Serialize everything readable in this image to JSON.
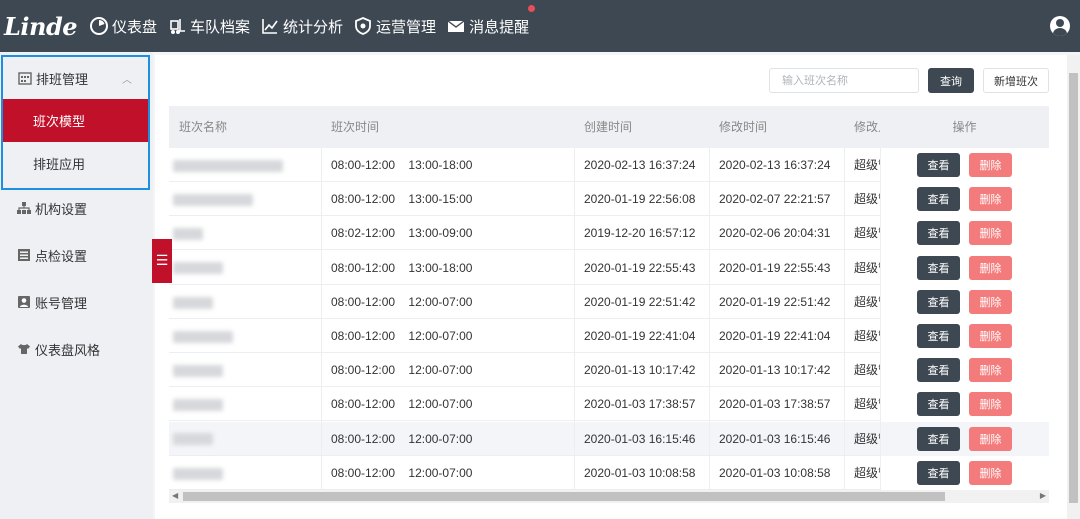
{
  "app": {
    "logo_text": "Linde",
    "brand_color": "#c0102a",
    "topbar_color": "#3d4852"
  },
  "nav": [
    {
      "label": "仪表盘",
      "icon": "gauge-icon"
    },
    {
      "label": "车队档案",
      "icon": "forklift-icon"
    },
    {
      "label": "统计分析",
      "icon": "chart-icon"
    },
    {
      "label": "运营管理",
      "icon": "shield-icon"
    },
    {
      "label": "消息提醒",
      "icon": "mail-icon",
      "has_badge": true
    }
  ],
  "sidebar": {
    "group": {
      "label": "排班管理",
      "icon": "calendar-icon",
      "expanded": true,
      "items": [
        {
          "label": "班次模型",
          "active": true
        },
        {
          "label": "排班应用",
          "active": false
        }
      ]
    },
    "items": [
      {
        "label": "机构设置",
        "icon": "org-icon"
      },
      {
        "label": "点检设置",
        "icon": "checklist-icon"
      },
      {
        "label": "账号管理",
        "icon": "account-icon"
      },
      {
        "label": "仪表盘风格",
        "icon": "shirt-icon"
      }
    ]
  },
  "toolbar": {
    "search_placeholder": "输入班次名称",
    "query_label": "查询",
    "add_label": "新增班次"
  },
  "table": {
    "columns": [
      "班次名称",
      "班次时间",
      "创建时间",
      "修改时间",
      "修改人",
      "操作"
    ],
    "view_label": "查看",
    "delete_label": "删除",
    "rows": [
      {
        "time": "08:00-12:00    13:00-18:00",
        "created": "2020-02-13 16:37:24",
        "modified": "2020-02-13 16:37:24",
        "modifier": "超级管理员"
      },
      {
        "time": "08:00-12:00    13:00-15:00",
        "created": "2020-01-19 22:56:08",
        "modified": "2020-02-07 22:21:57",
        "modifier": "超级管理员"
      },
      {
        "time": "08:02-12:00    13:00-09:00",
        "created": "2019-12-20 16:57:12",
        "modified": "2020-02-06 20:04:31",
        "modifier": "超级管理员"
      },
      {
        "time": "08:00-12:00    13:00-18:00",
        "created": "2020-01-19 22:55:43",
        "modified": "2020-01-19 22:55:43",
        "modifier": "超级管理员"
      },
      {
        "time": "08:00-12:00    12:00-07:00",
        "created": "2020-01-19 22:51:42",
        "modified": "2020-01-19 22:51:42",
        "modifier": "超级管理员"
      },
      {
        "time": "08:00-12:00    12:00-07:00",
        "created": "2020-01-19 22:41:04",
        "modified": "2020-01-19 22:41:04",
        "modifier": "超级管理员"
      },
      {
        "time": "08:00-12:00    12:00-07:00",
        "created": "2020-01-13 10:17:42",
        "modified": "2020-01-13 10:17:42",
        "modifier": "超级管理员"
      },
      {
        "time": "08:00-12:00    12:00-07:00",
        "created": "2020-01-03 17:38:57",
        "modified": "2020-01-03 17:38:57",
        "modifier": "超级管理员"
      },
      {
        "time": "08:00-12:00    12:00-07:00",
        "created": "2020-01-03 16:15:46",
        "modified": "2020-01-03 16:15:46",
        "modifier": "超级管理员"
      },
      {
        "time": "08:00-12:00    12:00-07:00",
        "created": "2020-01-03 10:08:58",
        "modified": "2020-01-03 10:08:58",
        "modifier": "超级管理员"
      }
    ]
  }
}
